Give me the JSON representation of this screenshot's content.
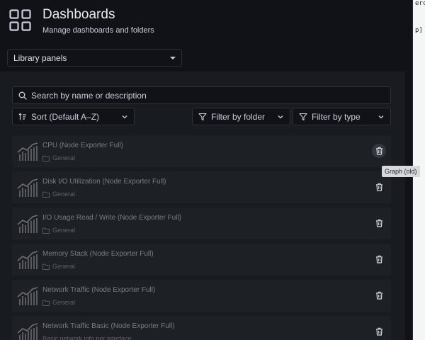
{
  "header": {
    "title": "Dashboards",
    "subtitle": "Manage dashboards and folders",
    "icon": "apps-grid-icon"
  },
  "type_select": {
    "value": "Library panels"
  },
  "search": {
    "placeholder": "Search by name or description"
  },
  "controls": {
    "sort_label": "Sort (Default A–Z)",
    "folder_filter_label": "Filter by folder",
    "type_filter_label": "Filter by type"
  },
  "panels": [
    {
      "title": "CPU (Node Exporter Full)",
      "subtitle": "General"
    },
    {
      "title": "Disk I/O Utilization (Node Exporter Full)",
      "subtitle": "General"
    },
    {
      "title": "I/O Usage Read / Write (Node Exporter Full)",
      "subtitle": "General"
    },
    {
      "title": "Memory Stack (Node Exporter Full)",
      "subtitle": "General"
    },
    {
      "title": "Network Traffic (Node Exporter Full)",
      "subtitle": "General"
    },
    {
      "title": "Network Traffic Basic (Node Exporter Full)",
      "subtitle": "Basic network info per interface"
    }
  ],
  "tooltip": {
    "text": "Graph (old)"
  },
  "backdrop": {
    "line1": "erce",
    "line2": "p]"
  },
  "colors": {
    "background": "#111217",
    "content": "#181b1f",
    "panel": "#1d2025",
    "tooltip": "#d7d8dd"
  }
}
